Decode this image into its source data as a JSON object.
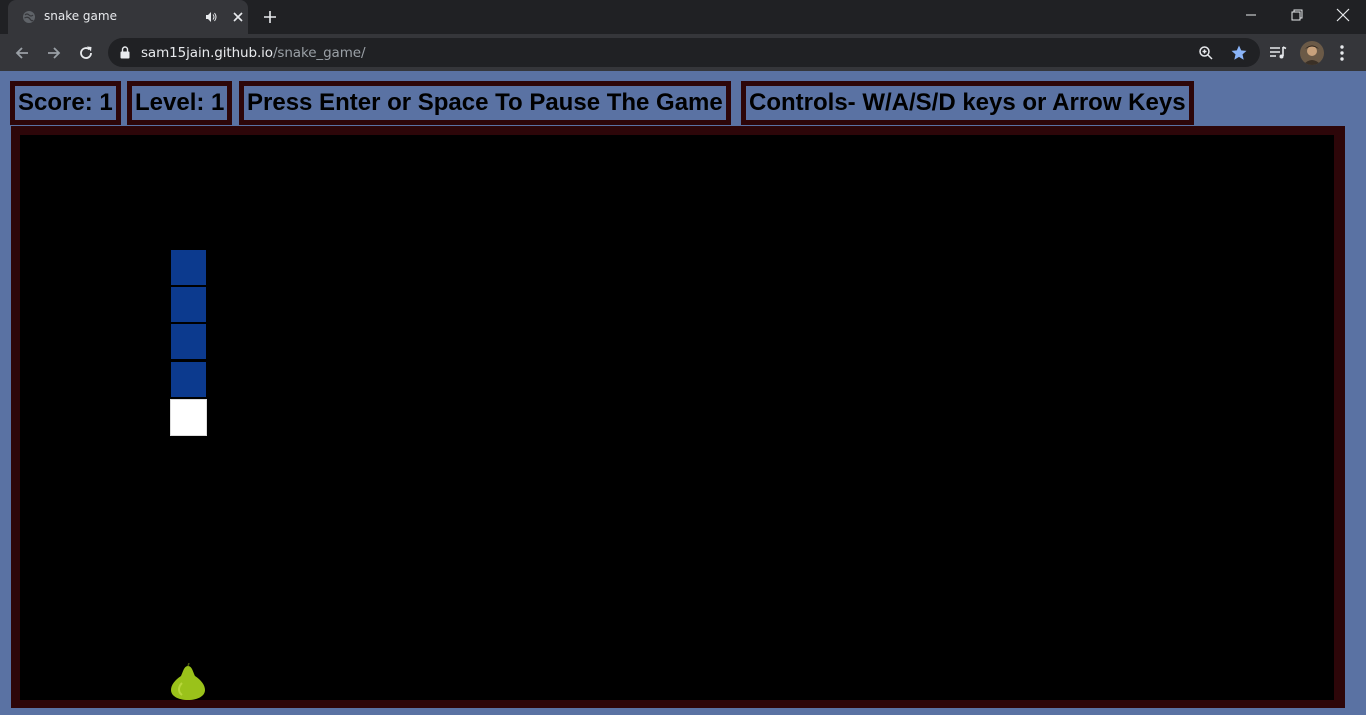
{
  "browser": {
    "tab_title": "snake game",
    "url_host": "sam15jain.github.io",
    "url_path": "/snake_game/",
    "colors": {
      "tabstrip": "#202124",
      "toolbar": "#35363a",
      "active_star": "#8ab4f8"
    }
  },
  "game": {
    "score_text": "Score: 1",
    "level_text": "Level: 1",
    "pause_hint": "Press Enter or Space To Pause The Game",
    "controls_hint": "Controls- W/A/S/D keys or Arrow Keys",
    "colors": {
      "page_background": "#5a72a3",
      "board_border": "#2d0609",
      "board_background": "#000000",
      "snake_body": "#0c3a8e",
      "snake_tail": "#ffffff",
      "food": "#9ac21a"
    },
    "snake_length": 5,
    "food_icon": "pear-icon"
  }
}
